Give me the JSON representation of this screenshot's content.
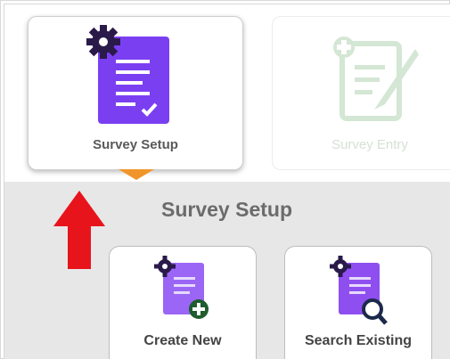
{
  "colors": {
    "accent_purple": "#7b3ff2",
    "accent_orange": "#f0952a",
    "alert_red": "#e8141b",
    "faded_green": "#d4e6d4"
  },
  "tiles": [
    {
      "label": "Survey Setup",
      "icon": "survey-setup-icon",
      "active": true
    },
    {
      "label": "Survey Entry",
      "icon": "survey-entry-icon",
      "active": false
    }
  ],
  "section": {
    "title": "Survey Setup"
  },
  "actions": [
    {
      "label": "Create New",
      "icon": "create-survey-icon"
    },
    {
      "label": "Search Existing",
      "icon": "search-survey-icon"
    }
  ]
}
